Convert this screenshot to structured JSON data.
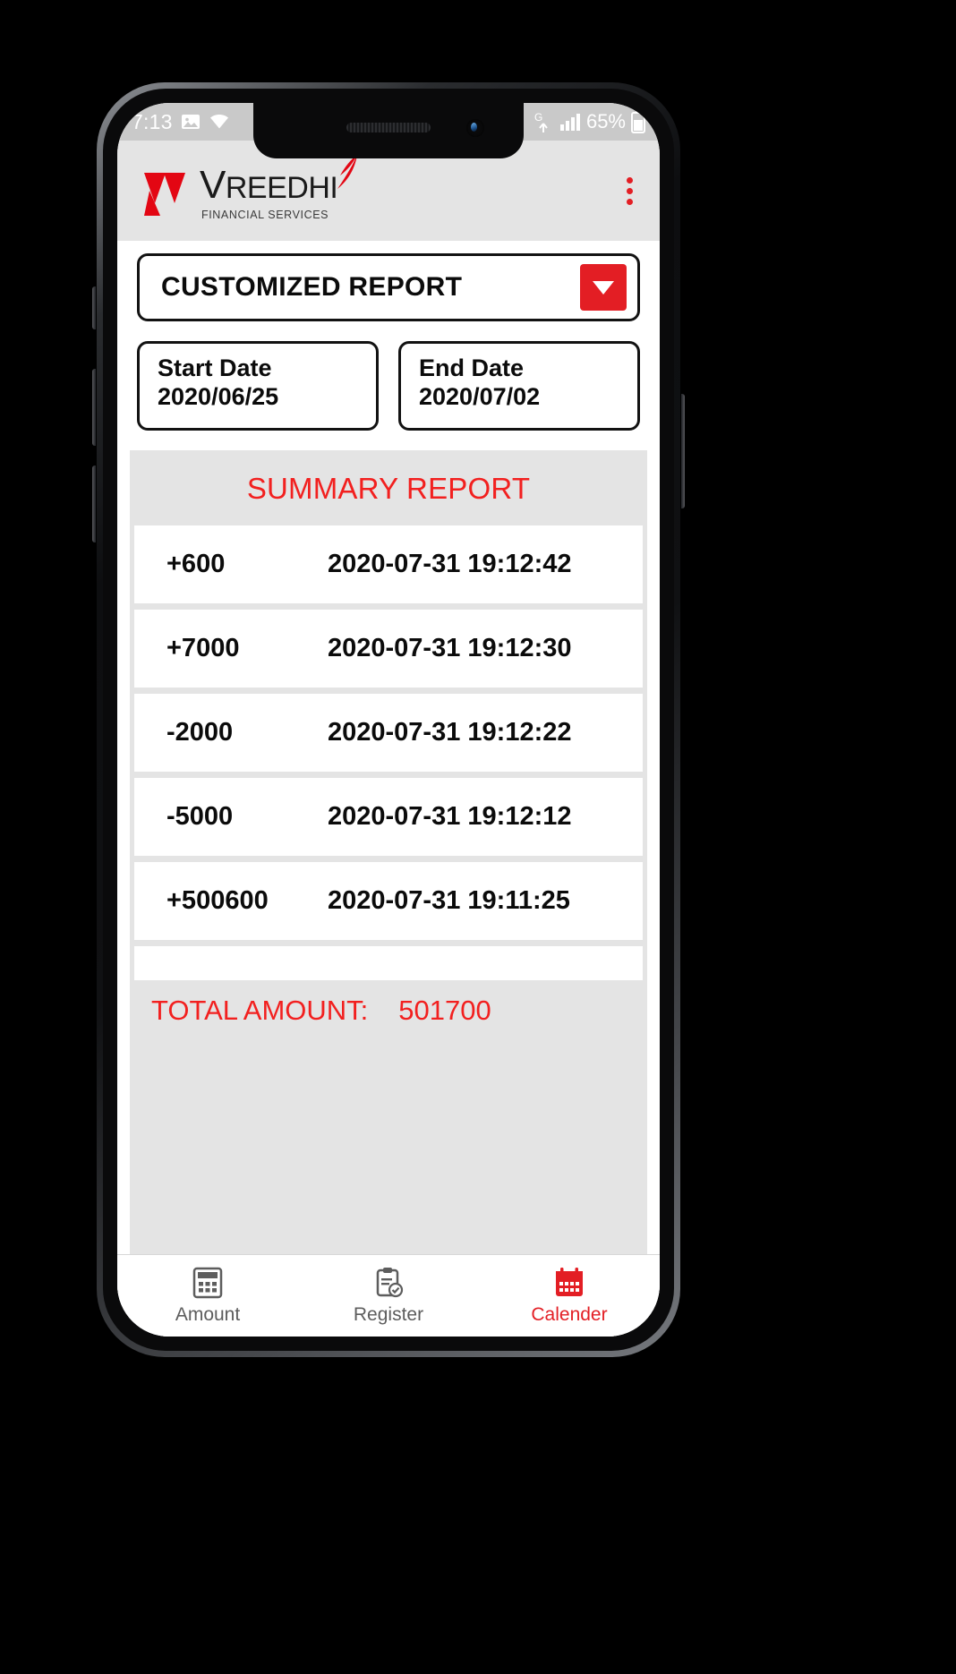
{
  "status_bar": {
    "time": "7:13",
    "battery_text": "65%",
    "network_label": "G",
    "icons": [
      "image-icon",
      "wifi-icon",
      "network-g-icon",
      "signal-bars-icon",
      "battery-icon"
    ]
  },
  "header": {
    "logo_main_v": "V",
    "logo_main_rest": "REEDHI",
    "logo_sub": "FINANCIAL SERVICES",
    "menu_icon": "overflow-menu-icon"
  },
  "controls": {
    "report_type_label": "CUSTOMIZED REPORT",
    "dropdown_icon": "chevron-down-icon",
    "start_date_title": "Start Date",
    "start_date_value": "2020/06/25",
    "end_date_title": "End Date",
    "end_date_value": "2020/07/02"
  },
  "summary": {
    "title": "SUMMARY REPORT",
    "rows": [
      {
        "amount": "+600",
        "datetime": "2020-07-31 19:12:42"
      },
      {
        "amount": "+7000",
        "datetime": "2020-07-31 19:12:30"
      },
      {
        "amount": "-2000",
        "datetime": "2020-07-31 19:12:22"
      },
      {
        "amount": "-5000",
        "datetime": "2020-07-31 19:12:12"
      },
      {
        "amount": "+500600",
        "datetime": "2020-07-31 19:11:25"
      }
    ],
    "total_label": "TOTAL AMOUNT:",
    "total_value": "501700"
  },
  "bottom_nav": {
    "items": [
      {
        "label": "Amount",
        "icon": "calculator-icon",
        "active": false
      },
      {
        "label": "Register",
        "icon": "clipboard-check-icon",
        "active": false
      },
      {
        "label": "Calender",
        "icon": "calendar-icon",
        "active": true
      }
    ]
  },
  "colors": {
    "brand_red": "#e31e24",
    "accent_red": "#f2201f",
    "panel_gray": "#e4e4e4",
    "statusbar_gray": "#c9c9c9"
  }
}
